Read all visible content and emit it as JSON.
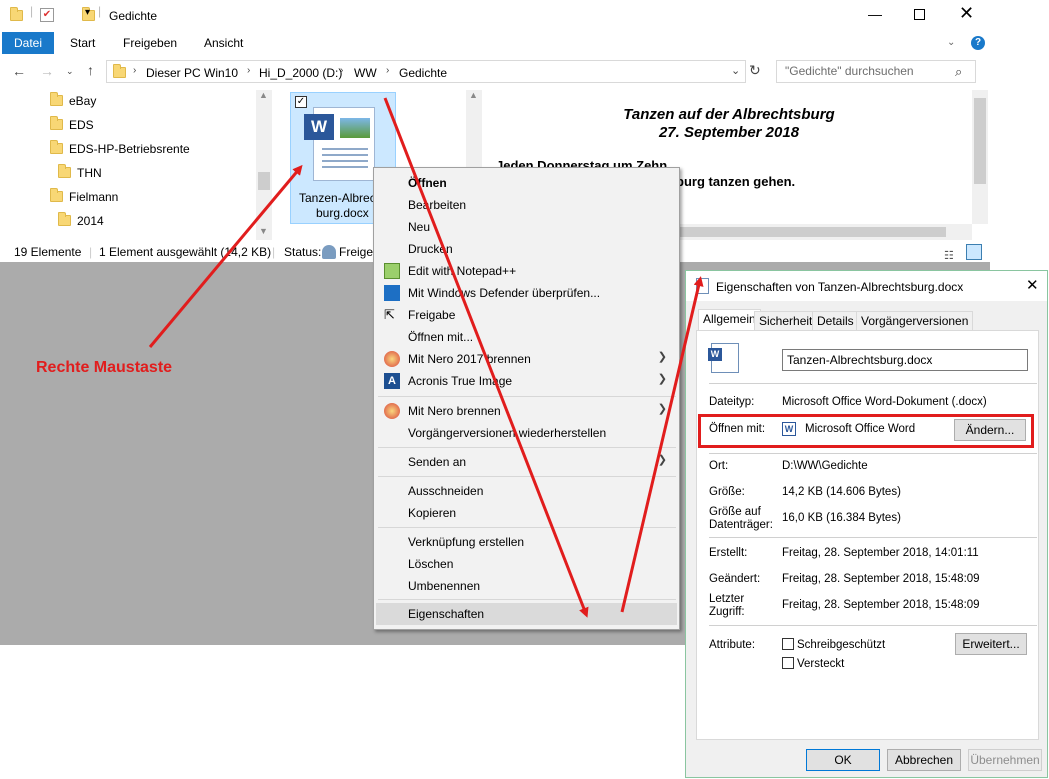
{
  "window": {
    "title": "Gedichte"
  },
  "ribbon": {
    "tabs": [
      "Datei",
      "Start",
      "Freigeben",
      "Ansicht"
    ]
  },
  "address": {
    "crumbs": [
      "Dieser PC Win10",
      "Hi_D_2000 (D:)",
      "WW",
      "Gedichte"
    ],
    "search_placeholder": "\"Gedichte\" durchsuchen"
  },
  "nav": {
    "items": [
      "eBay",
      "EDS",
      "EDS-HP-Betriebsrente",
      "THN",
      "Fielmann",
      "2014"
    ]
  },
  "file": {
    "name": "Tanzen-Albrechtsburg.docx",
    "name_line1": "Tanzen-Albrech",
    "name_line2": "burg.docx"
  },
  "preview": {
    "title": "Tanzen auf der Albrechtsburg",
    "date": "27. September 2018",
    "line1": "Jeden Donnerstag um Zehn",
    "line2": "burg tanzen gehen."
  },
  "status": {
    "count": "19 Elemente",
    "selected": "1 Element ausgewählt (14,2 KB)",
    "status_label": "Status:",
    "status_value": "Freigegeben"
  },
  "context_menu": {
    "items": [
      "Öffnen",
      "Bearbeiten",
      "Neu",
      "Drucken",
      "Edit with Notepad++",
      "Mit Windows Defender überprüfen...",
      "Freigabe",
      "Öffnen mit...",
      "Mit Nero 2017 brennen",
      "Acronis True Image",
      "Mit Nero brennen",
      "Vorgängerversionen wiederherstellen",
      "Senden an",
      "Ausschneiden",
      "Kopieren",
      "Verknüpfung erstellen",
      "Löschen",
      "Umbenennen",
      "Eigenschaften"
    ]
  },
  "annotation": {
    "text": "Rechte Maustaste",
    "color": "#e11d1d"
  },
  "dialog": {
    "title": "Eigenschaften von Tanzen-Albrechtsburg.docx",
    "tabs": [
      "Allgemein",
      "Sicherheit",
      "Details",
      "Vorgängerversionen"
    ],
    "filename": "Tanzen-Albrechtsburg.docx",
    "dateityp_label": "Dateityp:",
    "dateityp": "Microsoft Office Word-Dokument (.docx)",
    "oeffnen_label": "Öffnen mit:",
    "oeffnen": "Microsoft Office Word",
    "aendern": "Ändern...",
    "ort_label": "Ort:",
    "ort": "D:\\WW\\Gedichte",
    "groesse_label": "Größe:",
    "groesse": "14,2 KB (14.606 Bytes)",
    "groesse_auf_label1": "Größe auf",
    "groesse_auf_label2": "Datenträger:",
    "groesse_auf": "16,0 KB (16.384 Bytes)",
    "erstellt_label": "Erstellt:",
    "erstellt": "Freitag, 28. September 2018, 14:01:11",
    "geaendert_label": "Geändert:",
    "geaendert": "Freitag, 28. September 2018, 15:48:09",
    "letzter_label1": "Letzter",
    "letzter_label2": "Zugriff:",
    "letzter": "Freitag, 28. September 2018, 15:48:09",
    "attribute_label": "Attribute:",
    "schreib": "Schreibgeschützt",
    "versteckt": "Versteckt",
    "erweitert": "Erweitert...",
    "ok": "OK",
    "abbrechen": "Abbrechen",
    "uebernehmen": "Übernehmen"
  }
}
